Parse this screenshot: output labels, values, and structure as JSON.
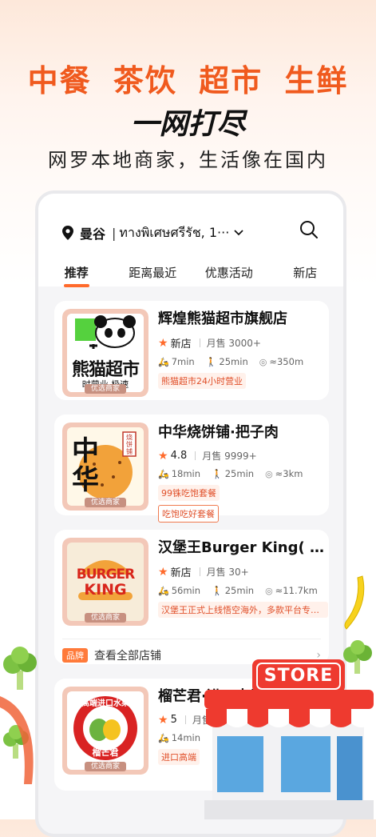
{
  "hero": {
    "categories": [
      "中餐",
      "茶饮",
      "超市",
      "生鲜"
    ],
    "slogan": "一网打尽",
    "description": "网罗本地商家，生活像在国内"
  },
  "location": {
    "city": "曼谷",
    "address": "ทางพิเศษศรีรัช, 1···"
  },
  "tabs": [
    "推荐",
    "距离最近",
    "优惠活动",
    "新店"
  ],
  "shops": [
    {
      "name": "辉煌熊猫超市旗舰店",
      "rating": "新店",
      "sales": "月售 3000+",
      "ride_time": "7min",
      "walk_time": "25min",
      "distance": "≈350m",
      "tags": [
        "熊猫超市24小时营业"
      ],
      "thumb_text": "熊猫超市",
      "thumb_sub": "时营业 极速",
      "badge": "优选商家"
    },
    {
      "name": "中华烧饼铺·把子肉",
      "rating": "4.8",
      "sales": "月售 9999+",
      "ride_time": "18min",
      "walk_time": "25min",
      "distance": "≈3km",
      "tags": [
        "99铢吃饱套餐",
        "吃饱吃好套餐"
      ],
      "thumb_text": "中华",
      "thumb_seal": "烧饼铺",
      "badge": "优选商家"
    },
    {
      "name": "汉堡王Burger King( C···",
      "rating": "新店",
      "sales": "月售 30+",
      "ride_time": "56min",
      "walk_time": "25min",
      "distance": "≈11.7km",
      "tags": [
        "汉堡王正式上线悟空海外，多款平台专享···"
      ],
      "thumb_text_top": "BURGER",
      "thumb_text_bottom": "KING",
      "badge": "优选商家",
      "brand_label": "品牌",
      "brand_link": "查看全部店铺"
    },
    {
      "name": "榴芒君·进口水果",
      "rating": "5",
      "sales": "月售",
      "ride_time": "14min",
      "tags": [
        "进口高端"
      ],
      "thumb_ring": "高端进口水果",
      "thumb_text": "榴芒君",
      "badge": "优选商家"
    }
  ],
  "store_sign": "STORE",
  "colors": {
    "accent": "#f05a1e",
    "tag_bg": "#fff1eb",
    "star": "#ff6a2b"
  },
  "icons": [
    "location-pin-icon",
    "search-icon",
    "chevron-down-icon",
    "star-icon",
    "scooter-icon",
    "walk-icon",
    "distance-pin-icon",
    "chevron-right-icon"
  ]
}
